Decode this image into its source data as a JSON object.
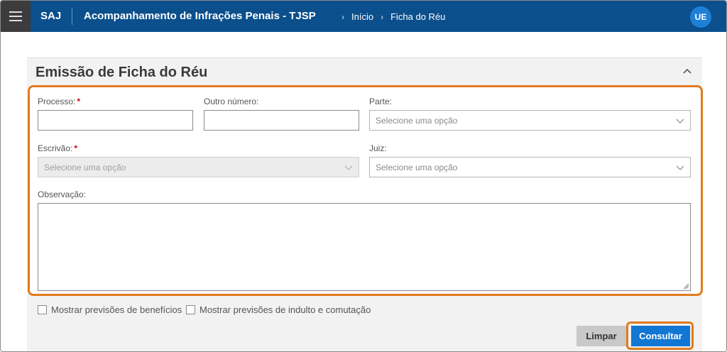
{
  "header": {
    "brand": "SAJ",
    "app_title": "Acompanhamento de Infrações Penais - TJSP",
    "breadcrumb": [
      "Início",
      "Ficha do Réu"
    ],
    "user_initials": "UE"
  },
  "panel": {
    "title": "Emissão de Ficha do Réu"
  },
  "form": {
    "processo_label": "Processo:",
    "processo_value": "",
    "outro_numero_label": "Outro número:",
    "outro_numero_value": "",
    "parte_label": "Parte:",
    "parte_placeholder": "Selecione uma opção",
    "escrivao_label": "Escrivão:",
    "escrivao_placeholder": "Selecione uma opção",
    "juiz_label": "Juiz:",
    "juiz_placeholder": "Selecione uma opção",
    "observacao_label": "Observação:",
    "observacao_value": "",
    "required_mark": "*"
  },
  "options": {
    "mostrar_beneficios": "Mostrar previsões de benefícios",
    "mostrar_indulto": "Mostrar previsões de indulto e comutação"
  },
  "actions": {
    "limpar": "Limpar",
    "consultar": "Consultar"
  },
  "colors": {
    "header_bg": "#0b4f8c",
    "primary_button": "#1276d3",
    "highlight": "#e07b1f",
    "required": "#d0021b"
  }
}
